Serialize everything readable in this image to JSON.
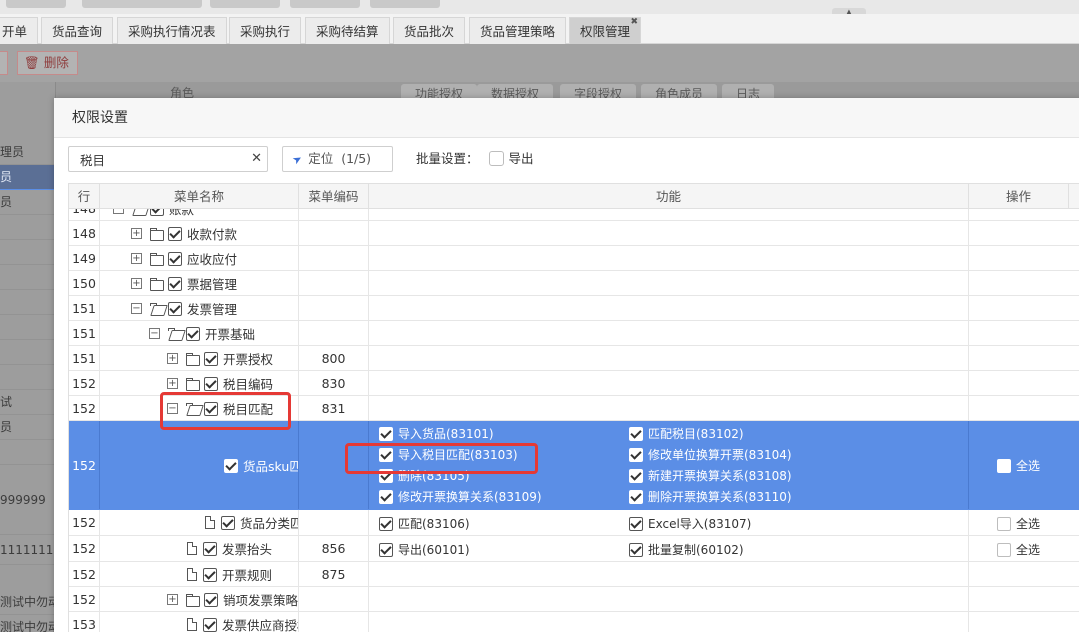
{
  "top_tabs": [
    {
      "label": "开单",
      "active": false
    },
    {
      "label": "货品查询",
      "active": false
    },
    {
      "label": "采购执行情况表",
      "active": false
    },
    {
      "label": "采购执行",
      "active": false
    },
    {
      "label": "采购待结算",
      "active": false
    },
    {
      "label": "货品批次",
      "active": false
    },
    {
      "label": "货品管理策略",
      "active": false
    },
    {
      "label": "权限管理",
      "active": true
    }
  ],
  "bg_toolbar": {
    "delete_label": "删除"
  },
  "bg_left_rows": [
    "理员",
    "员",
    "员",
    "",
    "",
    "",
    "",
    "",
    "",
    "",
    "",
    "试",
    "员",
    "",
    "",
    "999999",
    "",
    "1111111",
    "",
    "测试中勿动",
    "测试中勿动"
  ],
  "bg_headers": {
    "role": "角色",
    "tabs": [
      "功能授权",
      "数据授权",
      "字段授权",
      "角色成员",
      "日志"
    ]
  },
  "modal": {
    "title": "权限设置",
    "search_value": "税目",
    "locate_label": "定位",
    "locate_count": "(1/5)",
    "batch_label": "批量设置：",
    "export_label": "导出"
  },
  "grid": {
    "headers": {
      "row": "行",
      "menu_name": "菜单名称",
      "menu_code": "菜单编码",
      "function": "功能",
      "operation": "操作"
    },
    "rows": [
      {
        "no": "148",
        "name": "账款",
        "code": "",
        "type": "folder-open",
        "level": 1
      },
      {
        "no": "148",
        "name": "收款付款",
        "code": "",
        "type": "folder",
        "level": 1
      },
      {
        "no": "149",
        "name": "应收应付",
        "code": "",
        "type": "folder",
        "level": 1
      },
      {
        "no": "150",
        "name": "票据管理",
        "code": "",
        "type": "folder",
        "level": 1
      },
      {
        "no": "151",
        "name": "发票管理",
        "code": "",
        "type": "folder-open",
        "level": 1
      },
      {
        "no": "151",
        "name": "开票基础",
        "code": "",
        "type": "folder-open",
        "level": 2
      },
      {
        "no": "151",
        "name": "开票授权",
        "code": "800",
        "type": "folder",
        "level": 3
      },
      {
        "no": "152",
        "name": "税目编码",
        "code": "830",
        "type": "folder",
        "level": 3
      },
      {
        "no": "152",
        "name": "税目匹配",
        "code": "831",
        "type": "folder-open",
        "level": 3
      },
      {
        "no": "152",
        "name": "货品sku匹配",
        "code": "",
        "type": "doc",
        "level": 4,
        "selected": true,
        "functions": [
          "导入货品(83101)",
          "匹配税目(83102)",
          "导入税目匹配(83103)",
          "修改单位换算开票(83104)",
          "删除(83105)",
          "新建开票换算关系(83108)",
          "修改开票换算关系(83109)",
          "删除开票换算关系(83110)"
        ],
        "op": "全选"
      },
      {
        "no": "152",
        "name": "货品分类匹配",
        "code": "",
        "type": "doc",
        "level": 4,
        "functions": [
          "匹配(83106)",
          "Excel导入(83107)"
        ],
        "op": "全选"
      },
      {
        "no": "152",
        "name": "发票抬头",
        "code": "856",
        "type": "doc",
        "level": 3,
        "functions": [
          "导出(60101)",
          "批量复制(60102)"
        ],
        "op": "全选"
      },
      {
        "no": "152",
        "name": "开票规则",
        "code": "875",
        "type": "doc",
        "level": 3
      },
      {
        "no": "152",
        "name": "销项发票策略",
        "code": "",
        "type": "folder",
        "level": 3
      },
      {
        "no": "153",
        "name": "发票供应商授权",
        "code": "",
        "type": "doc",
        "level": 3
      }
    ]
  },
  "colors": {
    "selected_row": "#5b8ee6",
    "highlight_box": "#e53935",
    "locate_icon": "#3b6fd6"
  }
}
